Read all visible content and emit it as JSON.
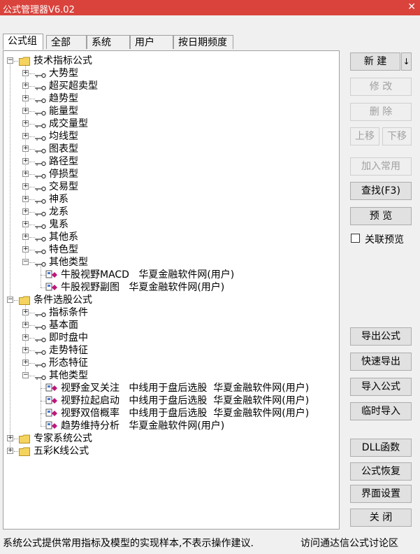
{
  "window": {
    "title": "公式管理器V6.02"
  },
  "tabs": [
    {
      "label": "公式组",
      "active": true
    },
    {
      "label": "全部"
    },
    {
      "label": "系统"
    },
    {
      "label": "用户"
    },
    {
      "label": "按日期频度"
    }
  ],
  "tree": [
    {
      "level": 0,
      "type": "folder",
      "label": "技术指标公式",
      "expanded": true
    },
    {
      "level": 1,
      "type": "group",
      "label": "大势型"
    },
    {
      "level": 1,
      "type": "group",
      "label": "超买超卖型"
    },
    {
      "level": 1,
      "type": "group",
      "label": "趋势型"
    },
    {
      "level": 1,
      "type": "group",
      "label": "能量型"
    },
    {
      "level": 1,
      "type": "group",
      "label": "成交量型"
    },
    {
      "level": 1,
      "type": "group",
      "label": "均线型"
    },
    {
      "level": 1,
      "type": "group",
      "label": "图表型"
    },
    {
      "level": 1,
      "type": "group",
      "label": "路径型"
    },
    {
      "level": 1,
      "type": "group",
      "label": "停损型"
    },
    {
      "level": 1,
      "type": "group",
      "label": "交易型"
    },
    {
      "level": 1,
      "type": "group",
      "label": "神系"
    },
    {
      "level": 1,
      "type": "group",
      "label": "龙系"
    },
    {
      "level": 1,
      "type": "group",
      "label": "鬼系"
    },
    {
      "level": 1,
      "type": "group",
      "label": "其他系"
    },
    {
      "level": 1,
      "type": "group",
      "label": "特色型"
    },
    {
      "level": 1,
      "type": "group",
      "label": "其他类型",
      "expanded": true
    },
    {
      "level": 2,
      "type": "formula",
      "label": "牛股视野MACD   华夏金融软件网(用户)"
    },
    {
      "level": 2,
      "type": "formula",
      "label": "牛股视野副图   华夏金融软件网(用户)"
    },
    {
      "level": 0,
      "type": "folder",
      "label": "条件选股公式",
      "expanded": true
    },
    {
      "level": 1,
      "type": "group",
      "label": "指标条件"
    },
    {
      "level": 1,
      "type": "group",
      "label": "基本面"
    },
    {
      "level": 1,
      "type": "group",
      "label": "即时盘中"
    },
    {
      "level": 1,
      "type": "group",
      "label": "走势特征"
    },
    {
      "level": 1,
      "type": "group",
      "label": "形态特征"
    },
    {
      "level": 1,
      "type": "group",
      "label": "其他类型",
      "expanded": true
    },
    {
      "level": 2,
      "type": "formula",
      "label": "视野金叉关注   中线用于盘后选股  华夏金融软件网(用户)"
    },
    {
      "level": 2,
      "type": "formula",
      "label": "视野拉起启动   中线用于盘后选股  华夏金融软件网(用户)"
    },
    {
      "level": 2,
      "type": "formula",
      "label": "视野双倍概率   中线用于盘后选股  华夏金融软件网(用户)"
    },
    {
      "level": 2,
      "type": "formula",
      "label": "趋势维持分析   华夏金融软件网(用户)"
    },
    {
      "level": 0,
      "type": "folder",
      "label": "专家系统公式"
    },
    {
      "level": 0,
      "type": "folder",
      "label": "五彩K线公式"
    }
  ],
  "buttons": {
    "new": "新  建",
    "new_arrow": "↓",
    "modify": "修  改",
    "delete": "删  除",
    "move_up": "上移",
    "move_down": "下移",
    "add_common": "加入常用",
    "find": "查找(F3)",
    "preview": "预  览",
    "export": "导出公式",
    "quick_export": "快速导出",
    "import": "导入公式",
    "temp_import": "临时导入",
    "dll": "DLL函数",
    "restore": "公式恢复",
    "ui_settings": "界面设置",
    "close": "关  闭"
  },
  "link_preview": {
    "label": "关联预览",
    "checked": false
  },
  "status": {
    "text": "系统公式提供常用指标及模型的实现样本,不表示操作建议.",
    "link": "访问通达信公式讨论区"
  },
  "colors": {
    "titlebar": "#d9433c",
    "folder": "#f4d35e",
    "formula_icon": "#c0157a"
  }
}
